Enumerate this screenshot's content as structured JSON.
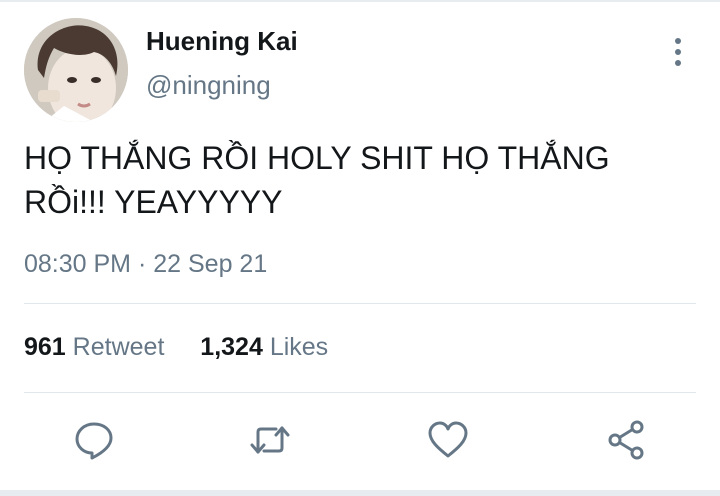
{
  "tweet": {
    "author": {
      "display_name": "Huening Kai",
      "handle": "@ningning",
      "avatar_icon": "profile-photo"
    },
    "text_line1": "HỌ THẮNG RỒI HOLY SHIT HỌ THẮNG",
    "text_line2": "RỒi!!! YEAYYYYY",
    "time": "08:30 PM",
    "separator": "·",
    "date": "22 Sep 21",
    "stats": {
      "retweets_count": "961",
      "retweets_label": "Retweet",
      "likes_count": "1,324",
      "likes_label": "Likes"
    },
    "actions": [
      "reply-icon",
      "retweet-icon",
      "like-icon",
      "share-icon"
    ],
    "colors": {
      "primary_text": "#14171a",
      "secondary_text": "#657786",
      "divider": "#e1e8ed"
    }
  }
}
